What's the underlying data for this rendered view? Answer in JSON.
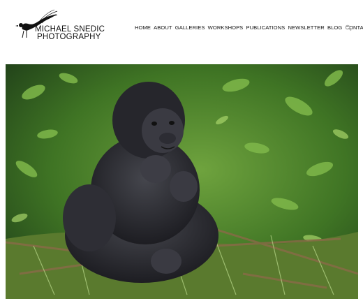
{
  "site": {
    "title_line1": "MICHAEL SNEDIC",
    "title_line2": "PHOTOGRAPHY",
    "logo_icon": "lyrebird-icon"
  },
  "nav": {
    "items": [
      {
        "label": "HOME"
      },
      {
        "label": "ABOUT"
      },
      {
        "label": "GALLERIES"
      },
      {
        "label": "WORKSHOPS"
      },
      {
        "label": "PUBLICATIONS"
      },
      {
        "label": "NEWSLETTER"
      },
      {
        "label": "BLOG"
      },
      {
        "label": "CONTACT"
      }
    ],
    "search_icon": "search-icon"
  },
  "hero": {
    "subject": "baby gorilla sitting in green foliage"
  },
  "colors": {
    "text": "#111111",
    "foliage": "#3c6a22",
    "gorilla": "#2a2a30"
  }
}
